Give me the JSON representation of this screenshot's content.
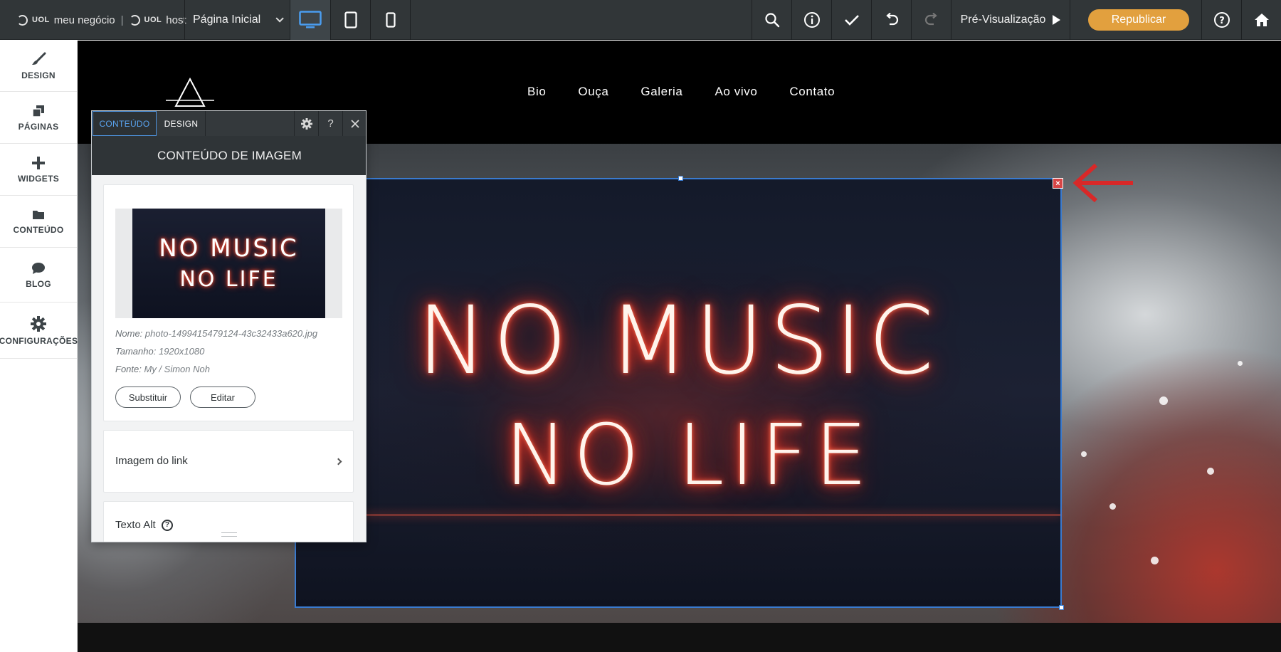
{
  "topbar": {
    "brand": {
      "uol1": "UOL",
      "product1": "meu negócio",
      "separator": "|",
      "uol2": "UOL",
      "product2": "host"
    },
    "page_select": {
      "value": "Página Inicial"
    },
    "devices": [
      "desktop",
      "tablet",
      "mobile"
    ],
    "active_device": "desktop",
    "tools": [
      "search-icon",
      "info-icon",
      "check-icon",
      "undo-icon",
      "redo-icon"
    ],
    "preview_label": "Pré-Visualização",
    "republish_label": "Republicar",
    "republish_color": "#e2a03e"
  },
  "sidebar": {
    "items": [
      {
        "label": "DESIGN",
        "icon": "brush-icon"
      },
      {
        "label": "PÁGINAS",
        "icon": "pages-icon"
      },
      {
        "label": "WIDGETS",
        "icon": "plus-icon"
      },
      {
        "label": "CONTEÚDO",
        "icon": "folder-icon"
      },
      {
        "label": "BLOG",
        "icon": "chat-bubble-icon"
      },
      {
        "label": "CONFIGURAÇÕES",
        "icon": "gear-icon"
      }
    ]
  },
  "site": {
    "nav": [
      "Bio",
      "Ouça",
      "Galeria",
      "Ao vivo",
      "Contato"
    ],
    "hero_image_text": {
      "line1": "NO MUSIC",
      "line2": "NO LIFE"
    },
    "selection_color": "#3a7bd0",
    "close_label": "×"
  },
  "panel": {
    "tabs": [
      {
        "label": "CONTEÚDO",
        "active": true
      },
      {
        "label": "DESIGN",
        "active": false
      }
    ],
    "header_icons": [
      "settings-icon",
      "help-icon",
      "close-icon"
    ],
    "help_label": "?",
    "title": "CONTEÚDO DE IMAGEM",
    "thumbnail_text": {
      "line1": "NO MUSIC",
      "line2": "NO LIFE"
    },
    "meta": {
      "name_label": "Nome:",
      "name_value": "photo-1499415479124-43c32433a620.jpg",
      "size_label": "Tamanho:",
      "size_value": "1920x1080",
      "source_label": "Fonte:",
      "source_value": "My / Simon Noh"
    },
    "replace_label": "Substituir",
    "edit_label": "Editar",
    "link_label": "Imagem do link",
    "alt_label": "Texto Alt"
  },
  "annotation": {
    "arrow_color": "#d82828"
  }
}
